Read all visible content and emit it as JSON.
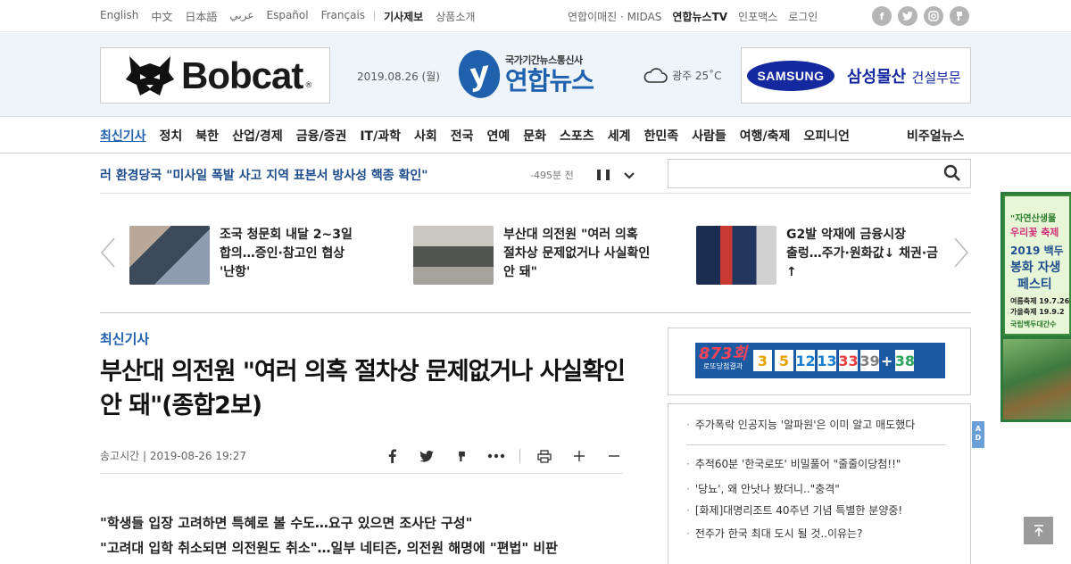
{
  "languages": [
    "English",
    "中文",
    "日本語",
    "عربي",
    "Español",
    "Français"
  ],
  "top_links": [
    "기사제보",
    "상품소개"
  ],
  "util_links": [
    "연합이매진 · MIDAS",
    "연합뉴스TV",
    "인포맥스",
    "로그인"
  ],
  "social_icons": [
    "facebook-icon",
    "twitter-icon",
    "instagram-icon",
    "kakao-story-icon"
  ],
  "header": {
    "left_ad": {
      "brand": "Bobcat",
      "trademark": "®"
    },
    "date": "2019.08.26 (월)",
    "logo": {
      "tagline": "국가기간뉴스통신사",
      "name": "연합뉴스",
      "mark": "y"
    },
    "weather": {
      "icon": "cloud-icon",
      "text": "광주 25˚C"
    },
    "right_ad": {
      "brand": "SAMSUNG",
      "company": "삼성물산",
      "division": "건설부문"
    }
  },
  "nav": {
    "items": [
      "최신기사",
      "정치",
      "북한",
      "산업/경제",
      "금융/증권",
      "IT/과학",
      "사회",
      "전국",
      "연예",
      "문화",
      "스포츠",
      "세계",
      "한민족",
      "사람들",
      "여행/축제",
      "오피니언"
    ],
    "active": "최신기사",
    "visual": "비주얼뉴스"
  },
  "ticker": {
    "headline": "러 환경당국 \"미사일 폭발 사고 지역 표본서 방사성 핵종 확인\"",
    "time": "-495분 전",
    "pause": "❚❚",
    "expand": "⌄"
  },
  "search": {
    "placeholder": ""
  },
  "carousel": [
    {
      "title": "조국 청문회 내달 2~3일 합의…증인·참고인 협상 '난항'",
      "thumb_color": "#6d7e92"
    },
    {
      "title": "부산대 의전원 \"여러 의혹 절차상 문제없거나 사실확인 안 돼\"",
      "thumb_color": "#8a8f8a"
    },
    {
      "title": "G2발 악재에 금융시장 출렁…주가·원화값↓ 채권·금↑",
      "thumb_color": "#2a3f6a"
    }
  ],
  "article": {
    "section": "최신기사",
    "headline": "부산대 의전원 \"여러 의혹 절차상 문제없거나 사실확인 안 돼\"(종합2보)",
    "meta": "송고시간 | 2019-08-26 19:27",
    "subheads": [
      "\"학생들 입장 고려하면 특혜로 볼 수도…요구 있으면 조사단 구성\"",
      "\"고려대 입학 취소되면 의전원도 취소\"…일부 네티즌, 의전원 해명에 \"편법\" 비판"
    ],
    "tools": [
      "facebook-icon",
      "twitter-icon",
      "kakao-story-icon",
      "more-icon",
      "print-icon",
      "zoom-in-icon",
      "zoom-out-icon"
    ]
  },
  "lotto": {
    "round": "873회",
    "label": "로또당첨결과",
    "numbers": [
      {
        "n": "3",
        "color": "#e8a100"
      },
      {
        "n": "5",
        "color": "#e8a100"
      },
      {
        "n": "12",
        "color": "#1b7fd1"
      },
      {
        "n": "13",
        "color": "#1b7fd1"
      },
      {
        "n": "33",
        "color": "#e63c3c"
      },
      {
        "n": "39",
        "color": "#7f7f7f"
      }
    ],
    "plus": "+",
    "bonus": {
      "n": "38",
      "color": "#2aa55a"
    }
  },
  "right_list": {
    "top": "주가폭락 인공지능 '알파원'은 이미 알고 매도했다",
    "items": [
      "추적60분 '한국로또' 비밀풀어 \"줄줄이당첨!!\"",
      "'당뇨', 왜 안낫나 봤더니..\"충격\"",
      "[화제]대명리조트 40주년 기념 특별한 분양중!",
      "전주가 한국 최대 도시 될 것..이유는?"
    ]
  },
  "ad_tag": "AD",
  "side_ad": {
    "lines": [
      "\"자연산생물",
      "우리꽃 축제",
      "2019 백두",
      "봉화 자생",
      "페스티",
      "여름축제 19.7.26",
      "가을축제 19.9.2",
      "국립백두대간수"
    ]
  },
  "totop": "↑"
}
